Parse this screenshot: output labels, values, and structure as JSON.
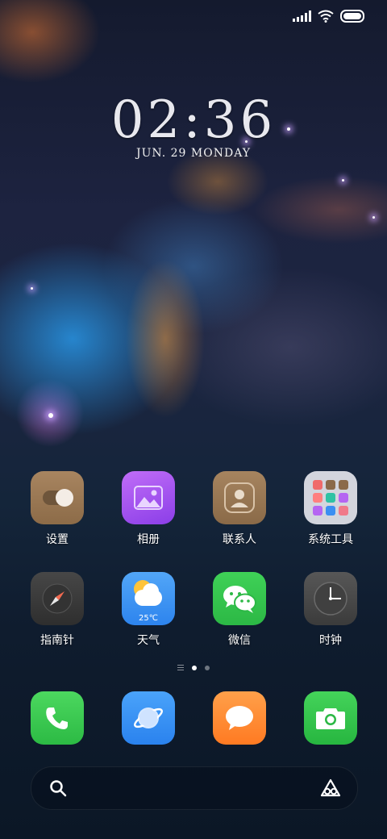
{
  "clock": {
    "time": "02:36",
    "date": "JUN. 29 MONDAY"
  },
  "apps_row1": [
    {
      "label": "设置",
      "icon": "settings-toggle-icon"
    },
    {
      "label": "相册",
      "icon": "gallery-icon"
    },
    {
      "label": "联系人",
      "icon": "contacts-icon"
    },
    {
      "label": "系统工具",
      "icon": "system-tools-folder-icon"
    }
  ],
  "apps_row2": [
    {
      "label": "指南针",
      "icon": "compass-icon"
    },
    {
      "label": "天气",
      "icon": "weather-icon",
      "temp": "25℃"
    },
    {
      "label": "微信",
      "icon": "wechat-icon"
    },
    {
      "label": "时钟",
      "icon": "clock-icon"
    }
  ],
  "dock": [
    {
      "icon": "phone-icon",
      "color": "#34c44a"
    },
    {
      "icon": "browser-icon",
      "color": "#2f8ef5"
    },
    {
      "icon": "messages-icon",
      "color": "#ff8a2a"
    },
    {
      "icon": "camera-icon",
      "color": "#2ec24a"
    }
  ],
  "pager": {
    "pages": 2,
    "active": 1
  },
  "colors": {
    "settings": "#9c7a56",
    "gallery": "#a855f0",
    "contacts": "#9a7856",
    "compass": "#3a3a3a",
    "weather": "#3a8ff2",
    "wechat": "#34c44a",
    "clock": "#4a4a4a"
  }
}
